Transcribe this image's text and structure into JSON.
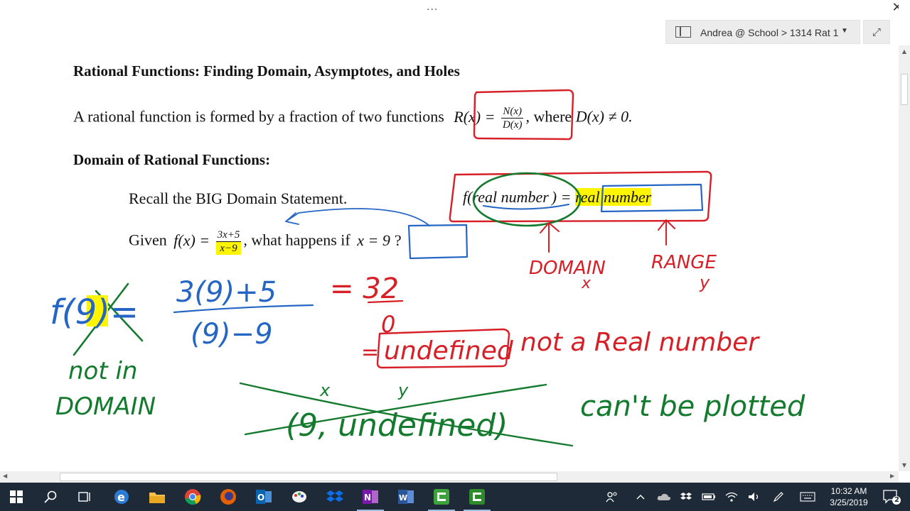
{
  "window": {
    "dots": "...",
    "close_glyph": "✕",
    "notebook_path": "Andrea @ School > 1314 Rat 1",
    "expand_glyph": "⤢"
  },
  "doc": {
    "title": "Rational Functions: Finding Domain, Asymptotes, and Holes",
    "intro_text": "A rational function is formed by a fraction of two functions",
    "intro_R": "R(x) =",
    "intro_num": "N(x)",
    "intro_den": "D(x)",
    "intro_where": ", where",
    "intro_cond": "D(x) ≠ 0.",
    "domain_heading": "Domain of Rational Functions:",
    "recall": "Recall the BIG Domain Statement.",
    "statement_f": "f(",
    "statement_real1": "real number",
    "statement_eq": ") =",
    "statement_real2": "real number",
    "given_text": "Given",
    "given_f": "f(x) =",
    "given_num": "3x+5",
    "given_den": "x−9",
    "given_question": ", what happens if",
    "given_cond": "x = 9",
    "given_end": "?"
  },
  "ink": {
    "domain_label": "DOMAIN",
    "domain_var": "x",
    "range_label": "RANGE",
    "range_var": "y",
    "lhs": "f(9)=",
    "frac_num": "3(9)+5",
    "frac_den": "(9)−9",
    "eq_result": "= 32",
    "zero": "0",
    "equals2": "=",
    "undefined": "undefined",
    "not_real": "not a Real number",
    "not_in": "not in",
    "domain2": "DOMAIN",
    "pair_x": "x",
    "pair_y": "y",
    "pair": "(9, undefined)",
    "cant_plot": "can't be plotted",
    "colors": {
      "red": "#d61f26",
      "blue": "#2566c4",
      "green": "#137a2e",
      "highlight": "#fff500"
    }
  },
  "taskbar": {
    "icons": [
      "windows-start-icon",
      "search-icon",
      "task-view-icon",
      "edge-icon",
      "file-explorer-icon",
      "chrome-icon",
      "firefox-icon",
      "outlook-icon",
      "paint-icon",
      "dropbox-icon",
      "onenote-icon",
      "word-icon",
      "camtasia-icon",
      "camtasia-recorder-icon"
    ],
    "time": "10:32 AM",
    "date": "3/25/2019",
    "notification_count": "2"
  }
}
